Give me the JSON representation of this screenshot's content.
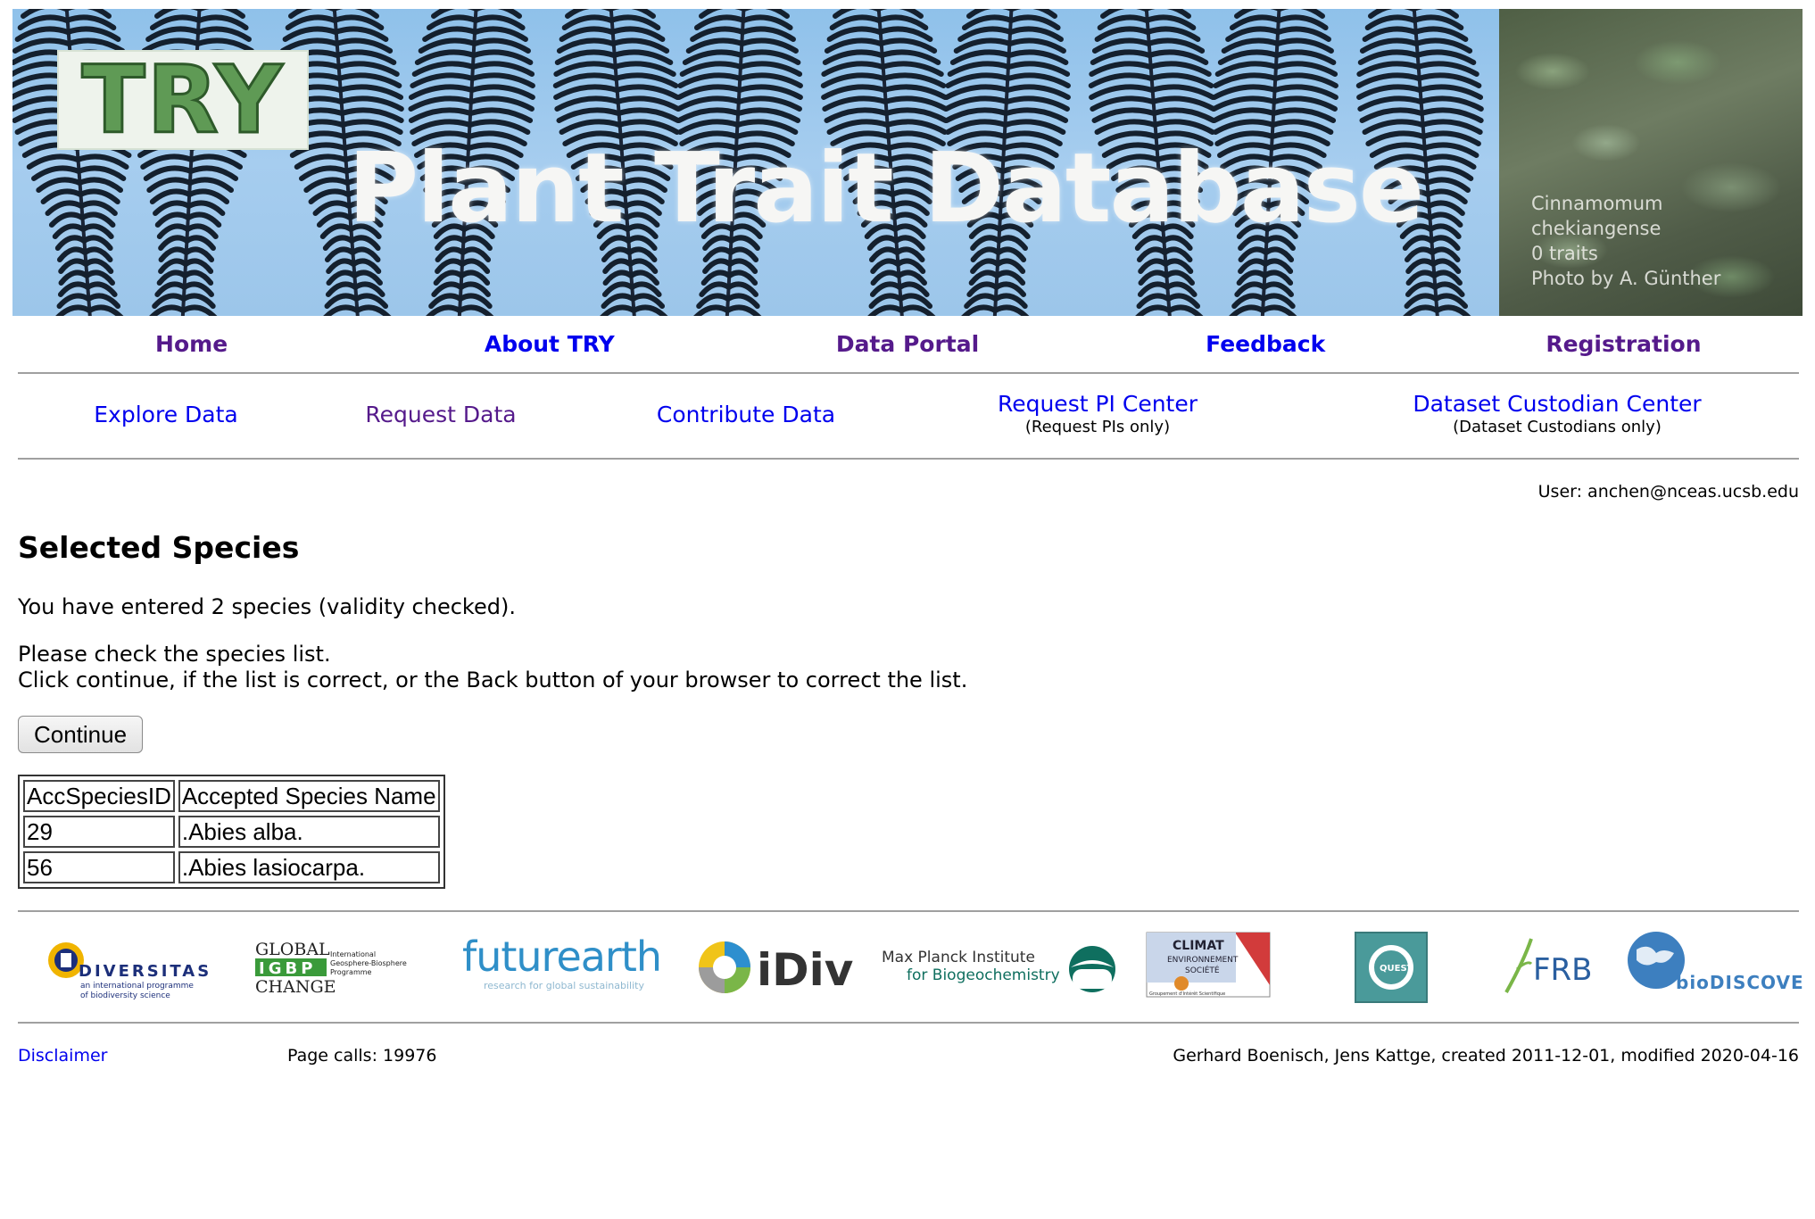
{
  "banner": {
    "logo_text": "TRY",
    "title": "Plant Trait Database",
    "photo_caption": [
      "Cinnamomum",
      "chekiangense",
      "0 traits",
      "Photo  by A. Günther"
    ]
  },
  "topnav": {
    "items": [
      {
        "label": "Home",
        "state": "visited"
      },
      {
        "label": "About TRY",
        "state": "link"
      },
      {
        "label": "Data Portal",
        "state": "visited"
      },
      {
        "label": "Feedback",
        "state": "link"
      },
      {
        "label": "Registration",
        "state": "visited"
      }
    ]
  },
  "subnav": {
    "explore": "Explore Data",
    "request": "Request Data",
    "contribute": "Contribute Data",
    "pi_center": "Request PI Center",
    "pi_center_note": "(Request PIs only)",
    "custodian_center": "Dataset Custodian Center",
    "custodian_center_note": "(Dataset Custodians only)"
  },
  "user_line": "User: anchen@nceas.ucsb.edu",
  "main": {
    "title": "Selected Species",
    "entered": "You have entered 2 species (validity checked).",
    "check_line1": "Please check the species list.",
    "check_line2": "Click continue, if the list is correct, or the Back button of your browser to correct the list.",
    "continue_label": "Continue",
    "table": {
      "headers": [
        "AccSpeciesID",
        "Accepted Species Name"
      ],
      "rows": [
        [
          "29",
          ".Abies alba."
        ],
        [
          "56",
          ".Abies lasiocarpa."
        ]
      ]
    }
  },
  "partners": {
    "diversitas": {
      "name": "DIVERSITAS",
      "tag1": "an international programme",
      "tag2": "of biodiversity science"
    },
    "igbp": {
      "line1": "GLOBAL",
      "mid": "IGBP",
      "line3": "CHANGE",
      "sub1": "International",
      "sub2": "Geosphere-Biosphere",
      "sub3": "Programme"
    },
    "futurearth": {
      "name": "futurearth",
      "tag": "research for global sustainability"
    },
    "idiv": {
      "name": "iDiv"
    },
    "mpi": {
      "line1": "Max Planck Institute",
      "line2": "for Biogeochemistry"
    },
    "climat": {
      "line1": "CLIMAT",
      "line2": "ENVIRONNEMENT",
      "line3": "SOCIÉTÉ",
      "tag": "Groupement d'Intérêt Scientifique"
    },
    "quest": {
      "name": "QUEST"
    },
    "frb": {
      "name": "FRB"
    },
    "biodiscovery": {
      "name": "bioDISCOVERY"
    }
  },
  "footer": {
    "disclaimer": "Disclaimer",
    "page_calls": "Page calls: 19976",
    "credit": "Gerhard Boenisch, Jens Kattge, created 2011-12-01, modified 2020-04-16"
  },
  "colors": {
    "link": "#0000ee",
    "visited": "#551a8b",
    "rule": "#a0a0a0"
  }
}
